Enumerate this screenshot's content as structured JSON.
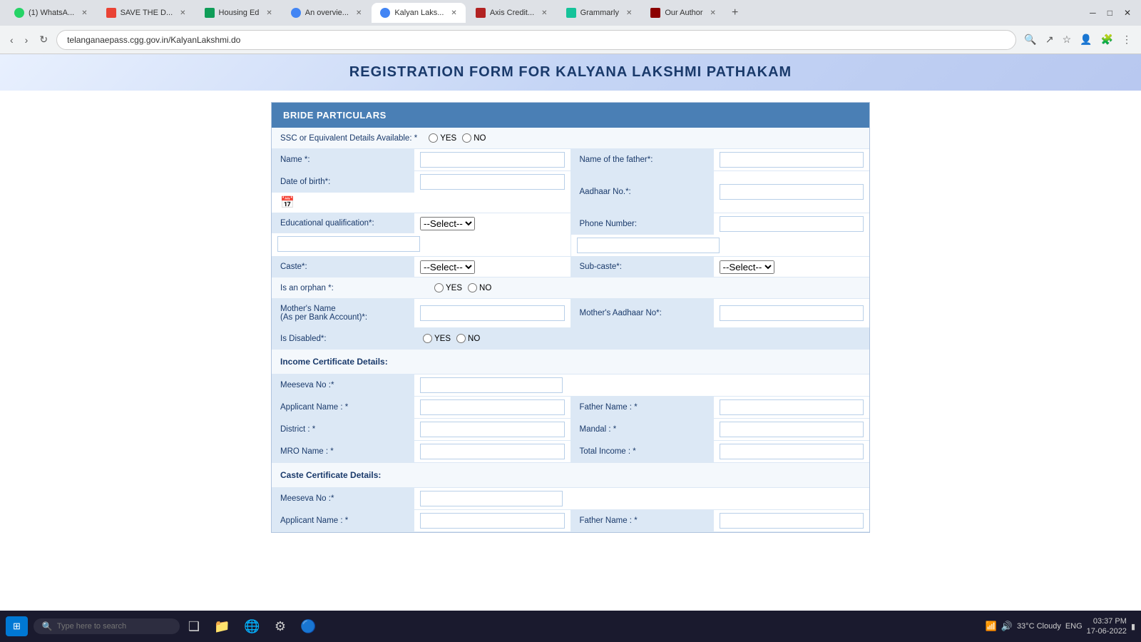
{
  "browser": {
    "url": "telanganaepass.cgg.gov.in/KalyanLakshmi.do",
    "tabs": [
      {
        "id": "whatsapp",
        "label": "(1) WhatsA...",
        "favicon_color": "#25d366",
        "active": false
      },
      {
        "id": "gmail",
        "label": "SAVE THE D...",
        "favicon_color": "#ea4335",
        "active": false
      },
      {
        "id": "housing",
        "label": "Housing Ed",
        "favicon_color": "#0f9d58",
        "active": false
      },
      {
        "id": "overview",
        "label": "An overvie...",
        "favicon_color": "#4285f4",
        "active": false
      },
      {
        "id": "kalyan",
        "label": "Kalyan Laks...",
        "favicon_color": "#4285f4",
        "active": true
      },
      {
        "id": "axis",
        "label": "Axis Credit...",
        "favicon_color": "#b22222",
        "active": false
      },
      {
        "id": "grammarly",
        "label": "Grammarly",
        "favicon_color": "#15c39a",
        "active": false
      },
      {
        "id": "ourauthor",
        "label": "Our Author",
        "favicon_color": "#8b0000",
        "active": false
      }
    ]
  },
  "page": {
    "title": "REGISTRATION FORM FOR KALYANA LAKSHMI PATHAKAM",
    "section": "BRIDE PARTICULARS",
    "ssc_label": "SSC or Equivalent Details Available: *",
    "ssc_yes": "YES",
    "ssc_no": "NO",
    "name_label": "Name *:",
    "father_name_label": "Name of the father*:",
    "dob_label": "Date of birth*:",
    "aadhaar_label": "Aadhaar No.*:",
    "edu_label": "Educational qualification*:",
    "edu_placeholder": "--Select--",
    "phone_label": "Phone Number:",
    "caste_label": "Caste*:",
    "caste_placeholder": "--Select--",
    "subcaste_label": "Sub-caste*:",
    "subcaste_placeholder": "--Select--",
    "orphan_label": "Is an orphan *:",
    "orphan_yes": "YES",
    "orphan_no": "NO",
    "mother_name_label": "Mother's Name\n(As per Bank Account)*:",
    "mother_aadhaar_label": "Mother's Aadhaar No*:",
    "disabled_label": "Is Disabled*:",
    "disabled_yes": "YES",
    "disabled_no": "NO",
    "income_section": "Income Certificate Details:",
    "meeseva_label": "Meeseva No :*",
    "applicant_label": "Applicant Name : *",
    "father_name2_label": "Father Name : *",
    "district_label": "District : *",
    "mandal_label": "Mandal : *",
    "mro_label": "MRO Name : *",
    "total_income_label": "Total Income : *",
    "caste_cert_section": "Caste Certificate Details:",
    "meeseva2_label": "Meeseva No :*",
    "applicant2_label": "Applicant Name : *",
    "father_name3_label": "Father Name : *"
  },
  "taskbar": {
    "search_placeholder": "Type here to search",
    "weather": "33°C Cloudy",
    "time": "03:37 PM",
    "date": "17-06-2022",
    "lang": "ENG"
  }
}
